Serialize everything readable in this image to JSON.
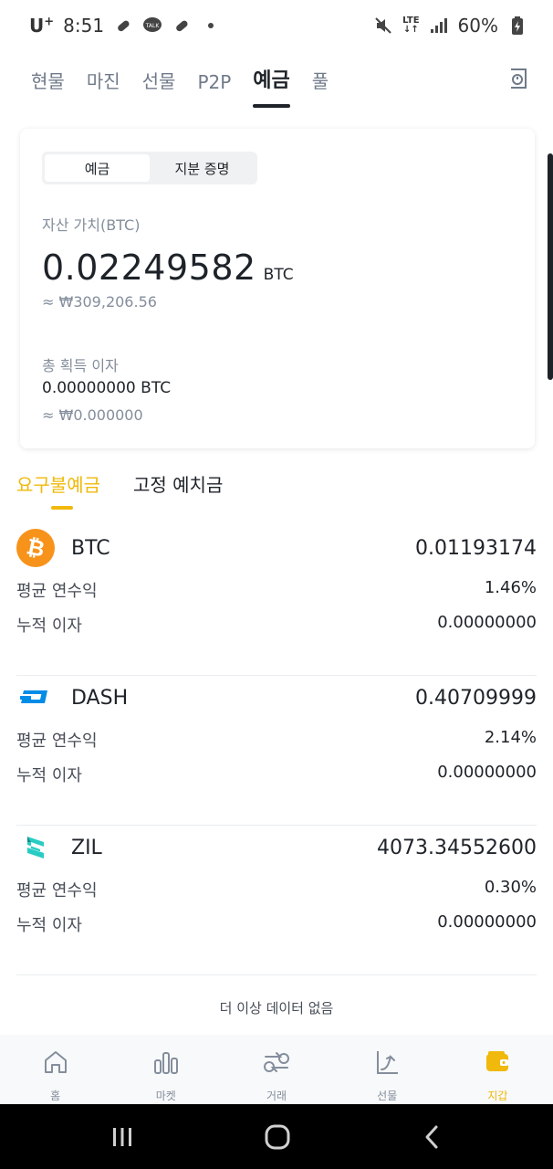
{
  "status_bar": {
    "carrier": "U",
    "carrier_sup": "+",
    "time": "8:51",
    "network": "LTE",
    "battery": "60%"
  },
  "top_tabs": [
    {
      "label": "현물"
    },
    {
      "label": "마진"
    },
    {
      "label": "선물"
    },
    {
      "label": "P2P"
    },
    {
      "label": "예금",
      "active": true
    },
    {
      "label": "풀"
    }
  ],
  "summary": {
    "segment": [
      "예금",
      "지분 증명"
    ],
    "asset_label": "자산 가치(BTC)",
    "asset_value": "0.02249582",
    "asset_unit": "BTC",
    "asset_krw": "≈ ₩309,206.56",
    "interest_label": "총 획득 이자",
    "interest_value": "0.00000000 BTC",
    "interest_krw": "≈ ₩0.000000"
  },
  "product_tabs": [
    {
      "label": "요구불예금",
      "active": true
    },
    {
      "label": "고정 예치금"
    }
  ],
  "coins": [
    {
      "symbol": "BTC",
      "amount": "0.01193174",
      "apy_label": "평균 연수익",
      "apy": "1.46%",
      "interest_label": "누적 이자",
      "interest": "0.00000000",
      "icon": "btc-icon"
    },
    {
      "symbol": "DASH",
      "amount": "0.40709999",
      "apy_label": "평균 연수익",
      "apy": "2.14%",
      "interest_label": "누적 이자",
      "interest": "0.00000000",
      "icon": "dash-icon"
    },
    {
      "symbol": "ZIL",
      "amount": "4073.34552600",
      "apy_label": "평균 연수익",
      "apy": "0.30%",
      "interest_label": "누적 이자",
      "interest": "0.00000000",
      "icon": "zil-icon"
    }
  ],
  "no_more": "더 이상 데이터 없음",
  "bottom_nav": [
    {
      "label": "홈",
      "icon": "home-icon"
    },
    {
      "label": "마켓",
      "icon": "bar-chart-icon"
    },
    {
      "label": "거래",
      "icon": "trade-icon"
    },
    {
      "label": "선물",
      "icon": "futures-icon"
    },
    {
      "label": "지갑",
      "icon": "wallet-icon",
      "active": true
    }
  ],
  "colors": {
    "accent": "#f0b90b",
    "text": "#1e2329",
    "muted": "#848e9c",
    "btc": "#f7931a",
    "dash": "#008ce7",
    "zil": "#29ccc4"
  }
}
